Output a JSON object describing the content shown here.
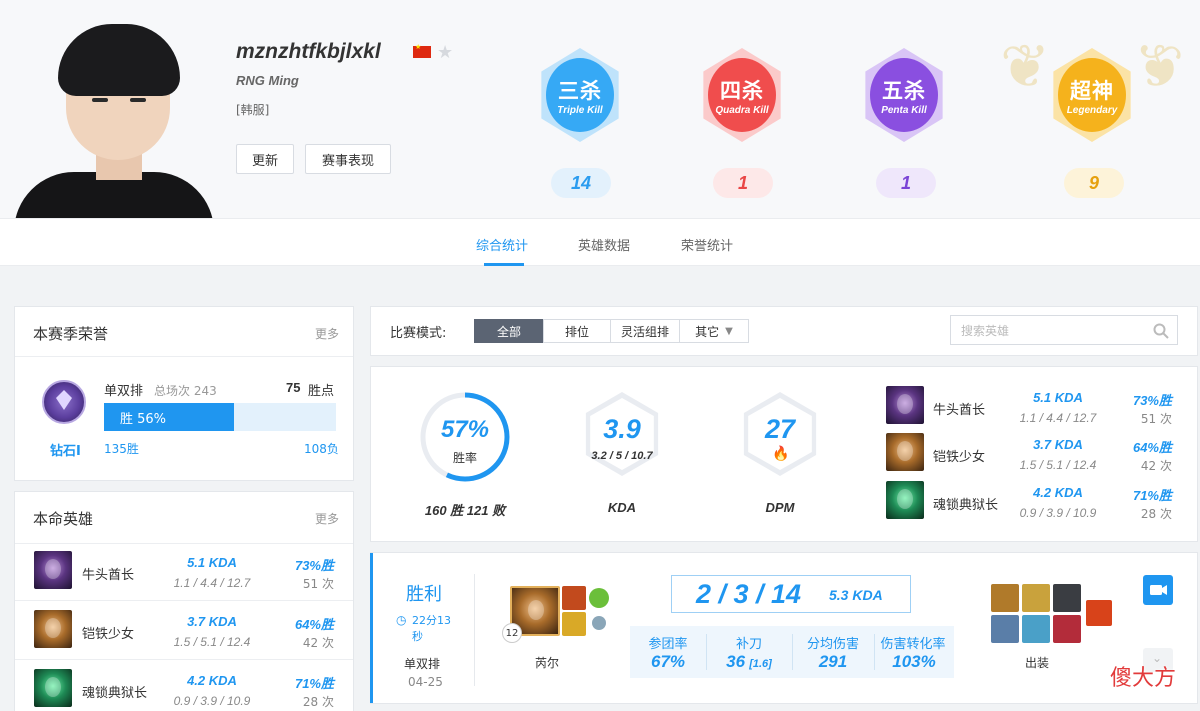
{
  "header": {
    "player_name": "mznzhtfkbjlxkl",
    "team": "RNG Ming",
    "server": "[韩服]",
    "buttons": {
      "refresh": "更新",
      "match_performance": "赛事表现"
    }
  },
  "badges": [
    {
      "big": "三杀",
      "small": "Triple Kill",
      "count": "14",
      "color": "#36a9f5",
      "pill_bg": "#e3f1fc",
      "pill_fg": "#2b9cef"
    },
    {
      "big": "四杀",
      "small": "Quadra Kill",
      "count": "1",
      "color": "#f04d4d",
      "pill_bg": "#fde8e8",
      "pill_fg": "#e94646"
    },
    {
      "big": "五杀",
      "small": "Penta Kill",
      "count": "1",
      "color": "#8a4fe0",
      "pill_bg": "#efe7fb",
      "pill_fg": "#7b44d6"
    },
    {
      "big": "超神",
      "small": "Legendary",
      "count": "9",
      "color": "#f5b21c",
      "pill_bg": "#fdf3d9",
      "pill_fg": "#e6a00d"
    }
  ],
  "tabs": [
    "综合统计",
    "英雄数据",
    "荣誉统计"
  ],
  "season_honor": {
    "title": "本赛季荣誉",
    "more": "更多",
    "queue": "单双排",
    "total_label": "总场次 243",
    "points": "75",
    "points_label": "胜点",
    "winrate_label": "胜 56%",
    "winrate": 0.56,
    "rank": "钻石I",
    "wins": "135胜",
    "losses": "108负"
  },
  "champions_panel": {
    "title": "本命英雄",
    "more": "更多"
  },
  "champions": [
    {
      "name": "牛头酋长",
      "kda": "5.1 KDA",
      "detail": "1.1 / 4.4 / 12.7",
      "winrate": "73%胜",
      "games": "51 次",
      "icon": "ic-purple"
    },
    {
      "name": "铠铁少女",
      "kda": "3.7 KDA",
      "detail": "1.5 / 5.1 / 12.4",
      "winrate": "64%胜",
      "games": "42 次",
      "icon": "ic-gold"
    },
    {
      "name": "魂锁典狱长",
      "kda": "4.2 KDA",
      "detail": "0.9 / 3.9 / 10.9",
      "winrate": "71%胜",
      "games": "28 次",
      "icon": "ic-green"
    }
  ],
  "filter": {
    "label": "比赛模式:",
    "options": [
      "全部",
      "排位",
      "灵活组排",
      "其它"
    ],
    "search_placeholder": "搜索英雄"
  },
  "summary": {
    "winrate_value": "57%",
    "winrate_fraction": 0.57,
    "winrate_label": "胜率",
    "record": "160 胜 121 败",
    "kda_value": "3.9",
    "kda_detail": "3.2 / 5 / 10.7",
    "kda_label": "KDA",
    "dpm_value": "27",
    "dpm_label": "DPM"
  },
  "match": {
    "result": "胜利",
    "duration": "22分13秒",
    "queue": "单双排",
    "date": "04-25",
    "champion_level": "12",
    "champion_name": "芮尔",
    "kda_line": "2 / 3 / 14",
    "kda_ratio": "5.3 KDA",
    "stats": [
      {
        "label": "参团率",
        "value": "67%"
      },
      {
        "label": "补刀",
        "value": "36",
        "extra": "[1.6]"
      },
      {
        "label": "分均伤害",
        "value": "291"
      },
      {
        "label": "伤害转化率",
        "value": "103%"
      }
    ],
    "items_label": "出装"
  },
  "watermark": "傻大方"
}
